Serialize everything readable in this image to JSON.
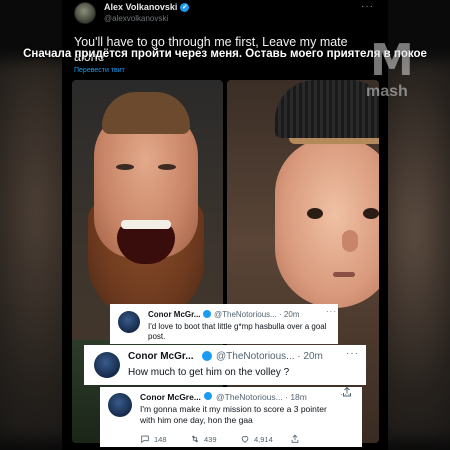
{
  "tweet": {
    "author_name": "Alex Volkanovski",
    "author_handle": "@alexvolkanovski",
    "text": "You'll have to go through me first, Leave my mate alone",
    "translate_link": "Перевести твит",
    "more_icon": "more-horizontal-icon"
  },
  "overlay": {
    "caption": "Сначала придётся пройти через меня. Оставь моего приятеля в покое",
    "watermark": "mash"
  },
  "replies": [
    {
      "name": "Conor McGr...",
      "handle": "@TheNotorious...",
      "time": "· 20m",
      "text": "I'd love to boot that little g*mp hasbulla over a goal post."
    },
    {
      "name": "Conor McGr...",
      "handle": "@TheNotorious...",
      "time": "· 20m",
      "text": "How much to get him on the volley ?"
    },
    {
      "name": "Conor McGre...",
      "handle": "@TheNotorious...",
      "time": "· 18m",
      "text": "I'm gonna make it my mission to score a 3 pointer with him one day, hon the gaa",
      "reply_count": "148",
      "retweet_count": "439",
      "like_count": "4,914"
    }
  ],
  "colors": {
    "accent": "#1d9bf0",
    "background": "#000000",
    "card_background": "#ffffff"
  }
}
